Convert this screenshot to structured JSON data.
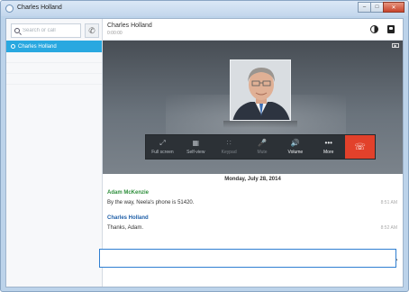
{
  "window": {
    "title": "Charles Holland"
  },
  "sidebar": {
    "search_placeholder": "Search or call",
    "contacts": [
      {
        "name": "Charles Holland",
        "selected": true
      }
    ]
  },
  "conversation": {
    "name": "Charles Holland",
    "duration": "0:00:00"
  },
  "call_controls": {
    "full_screen_label": "Full screen",
    "self_view_label": "Self-view",
    "keypad_label": "Keypad",
    "mute_label": "Mute",
    "volume_label": "Volume",
    "more_label": "More"
  },
  "chat": {
    "date": "Monday, July 28, 2014",
    "messages": [
      {
        "author": "Adam McKenzie",
        "text": "By the way, Neela's phone is 51420.",
        "time": "8:51 AM"
      },
      {
        "author": "Charles Holland",
        "text": "Thanks, Adam.",
        "time": "8:52 AM"
      }
    ]
  },
  "colors": {
    "accent": "#29a8e0",
    "hangup": "#e2412b",
    "author_green": "#2f8f3c",
    "author_blue": "#1f5fa8"
  }
}
